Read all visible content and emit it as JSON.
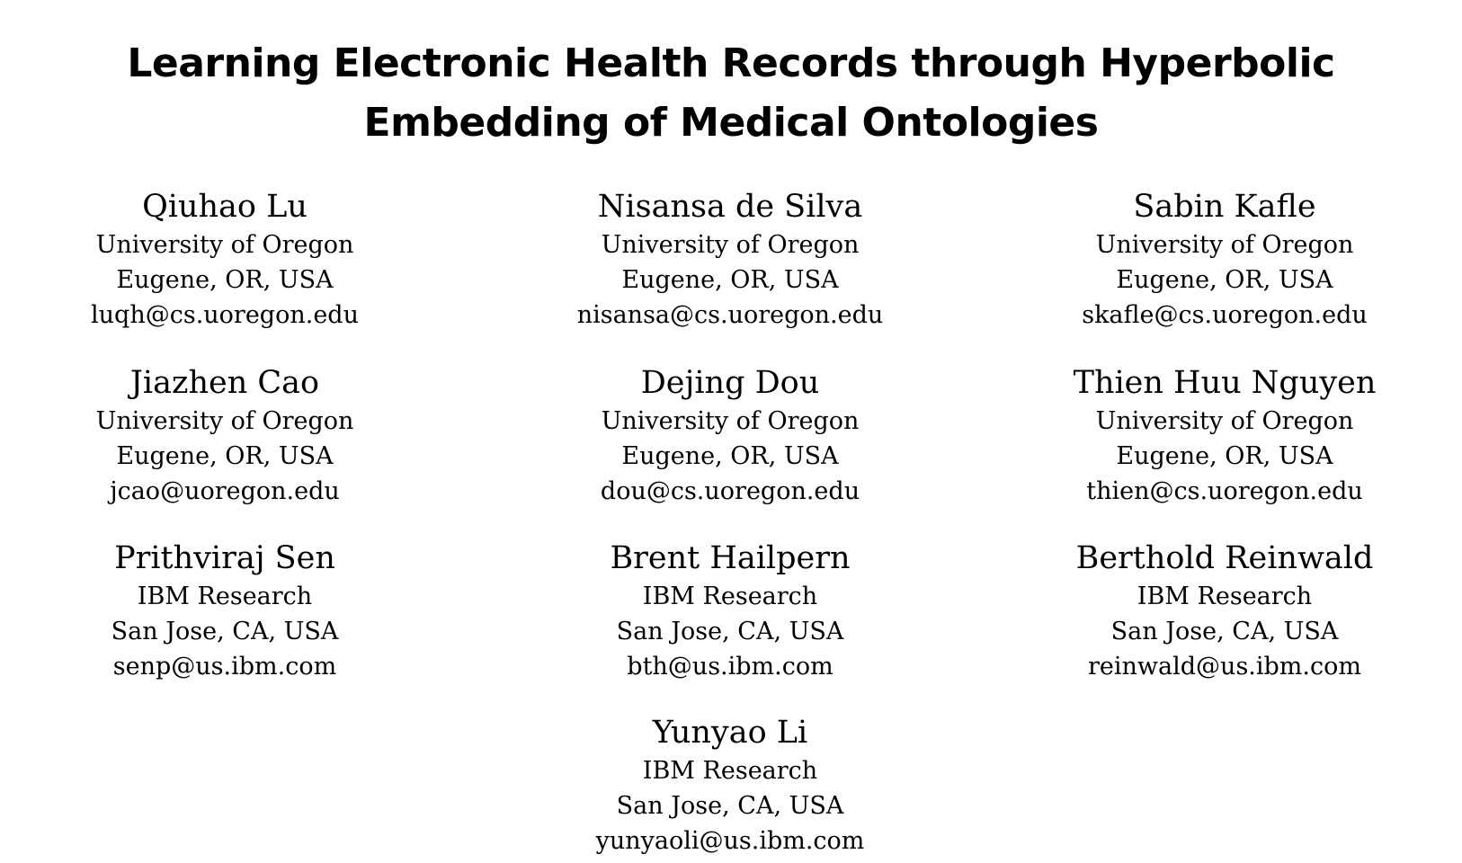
{
  "paper": {
    "title_line1": "Learning Electronic Health Records through Hyperbolic",
    "title_line2": "Embedding of Medical Ontologies",
    "authors": [
      {
        "name": "Qiuhao Lu",
        "affiliation": "University of Oregon",
        "location": "Eugene, OR, USA",
        "email": "luqh@cs.uoregon.edu"
      },
      {
        "name": "Nisansa de Silva",
        "affiliation": "University of Oregon",
        "location": "Eugene, OR, USA",
        "email": "nisansa@cs.uoregon.edu"
      },
      {
        "name": "Sabin Kafle",
        "affiliation": "University of Oregon",
        "location": "Eugene, OR, USA",
        "email": "skafle@cs.uoregon.edu"
      },
      {
        "name": "Jiazhen Cao",
        "affiliation": "University of Oregon",
        "location": "Eugene, OR, USA",
        "email": "jcao@uoregon.edu"
      },
      {
        "name": "Dejing Dou",
        "affiliation": "University of Oregon",
        "location": "Eugene, OR, USA",
        "email": "dou@cs.uoregon.edu"
      },
      {
        "name": "Thien Huu Nguyen",
        "affiliation": "University of Oregon",
        "location": "Eugene, OR, USA",
        "email": "thien@cs.uoregon.edu"
      },
      {
        "name": "Prithviraj Sen",
        "affiliation": "IBM Research",
        "location": "San Jose, CA, USA",
        "email": "senp@us.ibm.com"
      },
      {
        "name": "Brent Hailpern",
        "affiliation": "IBM Research",
        "location": "San Jose, CA, USA",
        "email": "bth@us.ibm.com"
      },
      {
        "name": "Berthold Reinwald",
        "affiliation": "IBM Research",
        "location": "San Jose, CA, USA",
        "email": "reinwald@us.ibm.com"
      },
      {
        "name": "Yunyao Li",
        "affiliation": "IBM Research",
        "location": "San Jose, CA, USA",
        "email": "yunyaoli@us.ibm.com"
      }
    ]
  }
}
